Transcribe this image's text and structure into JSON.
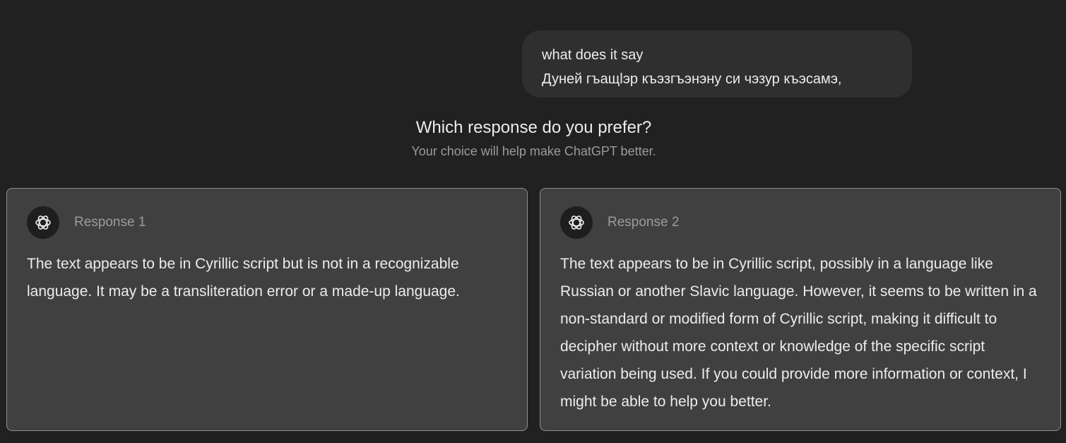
{
  "user_message": {
    "lines": [
      "what does it say",
      "Дуней гъащlэр къэзгъэнэну си чэзур къэсамэ,"
    ]
  },
  "comparison": {
    "heading": "Which response do you prefer?",
    "subheading": "Your choice will help make ChatGPT better."
  },
  "responses": [
    {
      "title": "Response 1",
      "icon": "openai-logo-icon",
      "text": "The text appears to be in Cyrillic script but is not in a recognizable language. It may be a transliteration error or a made-up language."
    },
    {
      "title": "Response 2",
      "icon": "openai-logo-icon",
      "text": "The text appears to be in Cyrillic script, possibly in a language like Russian or another Slavic language. However, it seems to be written in a non-standard or modified form of Cyrillic script, making it difficult to decipher without more context or knowledge of the specific script variation being used. If you could provide more information or context, I might be able to help you better."
    }
  ],
  "colors": {
    "background": "#212121",
    "bubble": "#2f2f2f",
    "card": "#404040",
    "card_border": "#8e8e8e",
    "text": "#ececec",
    "muted_text": "#9b9b9b"
  }
}
